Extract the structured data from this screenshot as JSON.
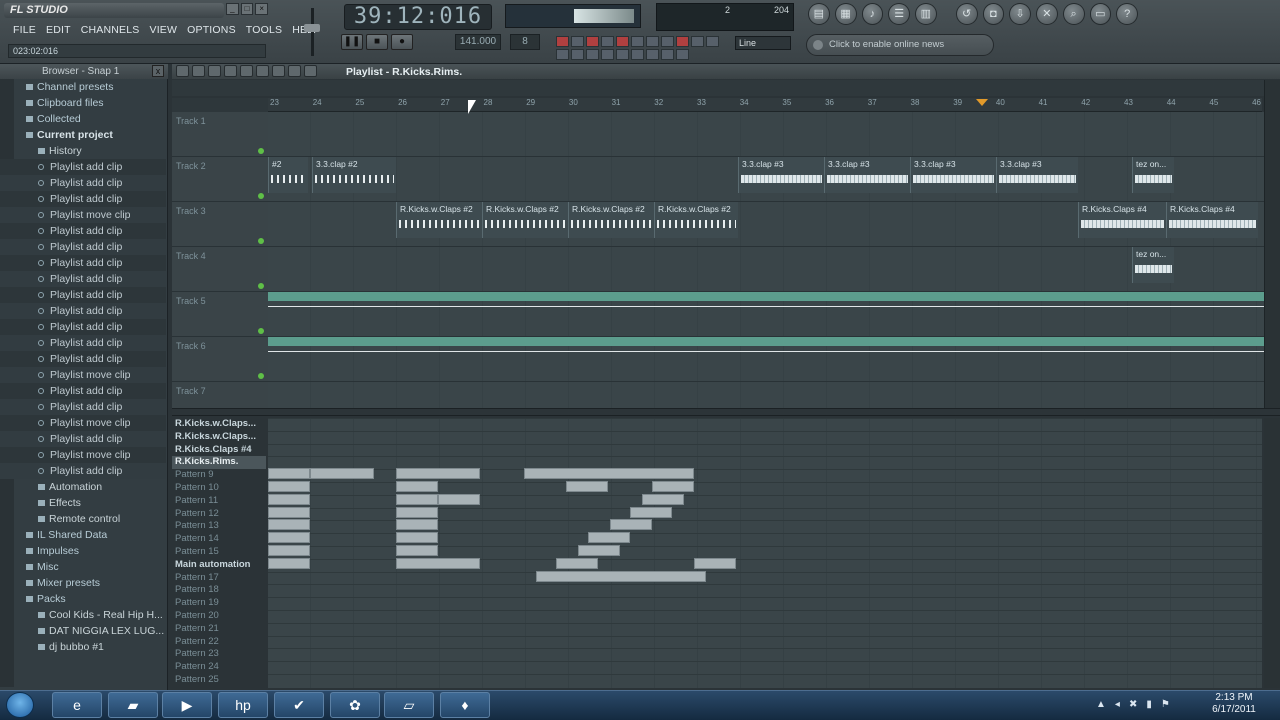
{
  "app": {
    "title": "FL STUDIO",
    "hint": "023:02:016"
  },
  "menu": [
    "FILE",
    "EDIT",
    "CHANNELS",
    "VIEW",
    "OPTIONS",
    "TOOLS",
    "HELP"
  ],
  "transport": {
    "time": "39:12:016",
    "tempo": "141.000",
    "pattern": "8",
    "snap": "Line"
  },
  "cpu": {
    "poly": "2",
    "mem": "204"
  },
  "news": "Click to enable online news",
  "browser": {
    "title": "Browser - Snap 1",
    "items": [
      {
        "label": "Channel presets",
        "level": 0
      },
      {
        "label": "Clipboard files",
        "level": 0
      },
      {
        "label": "Collected",
        "level": 0
      },
      {
        "label": "Current project",
        "level": 0,
        "bold": true
      },
      {
        "label": "History",
        "level": 1
      },
      {
        "label": "Playlist add clip",
        "level": 2
      },
      {
        "label": "Playlist add clip",
        "level": 2
      },
      {
        "label": "Playlist add clip",
        "level": 2
      },
      {
        "label": "Playlist move clip",
        "level": 2
      },
      {
        "label": "Playlist add clip",
        "level": 2
      },
      {
        "label": "Playlist add clip",
        "level": 2
      },
      {
        "label": "Playlist add clip",
        "level": 2
      },
      {
        "label": "Playlist add clip",
        "level": 2
      },
      {
        "label": "Playlist add clip",
        "level": 2
      },
      {
        "label": "Playlist add clip",
        "level": 2
      },
      {
        "label": "Playlist add clip",
        "level": 2
      },
      {
        "label": "Playlist add clip",
        "level": 2
      },
      {
        "label": "Playlist add clip",
        "level": 2
      },
      {
        "label": "Playlist move clip",
        "level": 2
      },
      {
        "label": "Playlist add clip",
        "level": 2
      },
      {
        "label": "Playlist add clip",
        "level": 2
      },
      {
        "label": "Playlist move clip",
        "level": 2
      },
      {
        "label": "Playlist add clip",
        "level": 2
      },
      {
        "label": "Playlist move clip",
        "level": 2
      },
      {
        "label": "Playlist add clip",
        "level": 2
      },
      {
        "label": "Automation",
        "level": 1
      },
      {
        "label": "Effects",
        "level": 1
      },
      {
        "label": "Remote control",
        "level": 1
      },
      {
        "label": "IL Shared Data",
        "level": 0
      },
      {
        "label": "Impulses",
        "level": 0
      },
      {
        "label": "Misc",
        "level": 0
      },
      {
        "label": "Mixer presets",
        "level": 0
      },
      {
        "label": "Packs",
        "level": 0
      },
      {
        "label": "Cool Kids - Real Hip H...",
        "level": 1
      },
      {
        "label": "DAT NIGGIA LEX LUG...",
        "level": 1
      },
      {
        "label": "dj bubbo #1",
        "level": 1
      }
    ]
  },
  "playlist": {
    "title": "Playlist - R.Kicks.Rims.",
    "ruler": [
      "23",
      "24",
      "25",
      "26",
      "27",
      "28",
      "29",
      "30",
      "31",
      "32",
      "33",
      "34",
      "35",
      "36",
      "37",
      "38",
      "39",
      "40",
      "41",
      "42",
      "43",
      "44",
      "45",
      "46"
    ],
    "tracks": [
      "Track 1",
      "Track 2",
      "Track 3",
      "Track 4",
      "Track 5",
      "Track 6",
      "Track 7"
    ],
    "clips": {
      "t2_first": "#2",
      "t2_a": "3.3.clap #2",
      "t2_b": "3.3.clap #3",
      "t3_a": "R.Kicks.w.Claps #2",
      "t3_b": "R.Kicks.Claps #4",
      "tez": "tez on..."
    }
  },
  "patterns": [
    {
      "label": "R.Kicks.w.Claps...",
      "state": "on"
    },
    {
      "label": "R.Kicks.w.Claps...",
      "state": "on"
    },
    {
      "label": "R.Kicks.Claps #4",
      "state": "on"
    },
    {
      "label": "R.Kicks.Rims.",
      "state": "sel"
    },
    {
      "label": "Pattern 9",
      "state": "off"
    },
    {
      "label": "Pattern 10",
      "state": "off"
    },
    {
      "label": "Pattern 11",
      "state": "off"
    },
    {
      "label": "Pattern 12",
      "state": "off"
    },
    {
      "label": "Pattern 13",
      "state": "off"
    },
    {
      "label": "Pattern 14",
      "state": "off"
    },
    {
      "label": "Pattern 15",
      "state": "off"
    },
    {
      "label": "Main automation",
      "state": "on"
    },
    {
      "label": "Pattern 17",
      "state": "off"
    },
    {
      "label": "Pattern 18",
      "state": "off"
    },
    {
      "label": "Pattern 19",
      "state": "off"
    },
    {
      "label": "Pattern 20",
      "state": "off"
    },
    {
      "label": "Pattern 21",
      "state": "off"
    },
    {
      "label": "Pattern 22",
      "state": "off"
    },
    {
      "label": "Pattern 23",
      "state": "off"
    },
    {
      "label": "Pattern 24",
      "state": "off"
    },
    {
      "label": "Pattern 25",
      "state": "off"
    }
  ],
  "taskbar": {
    "time": "2:13 PM",
    "date": "6/17/2011"
  }
}
